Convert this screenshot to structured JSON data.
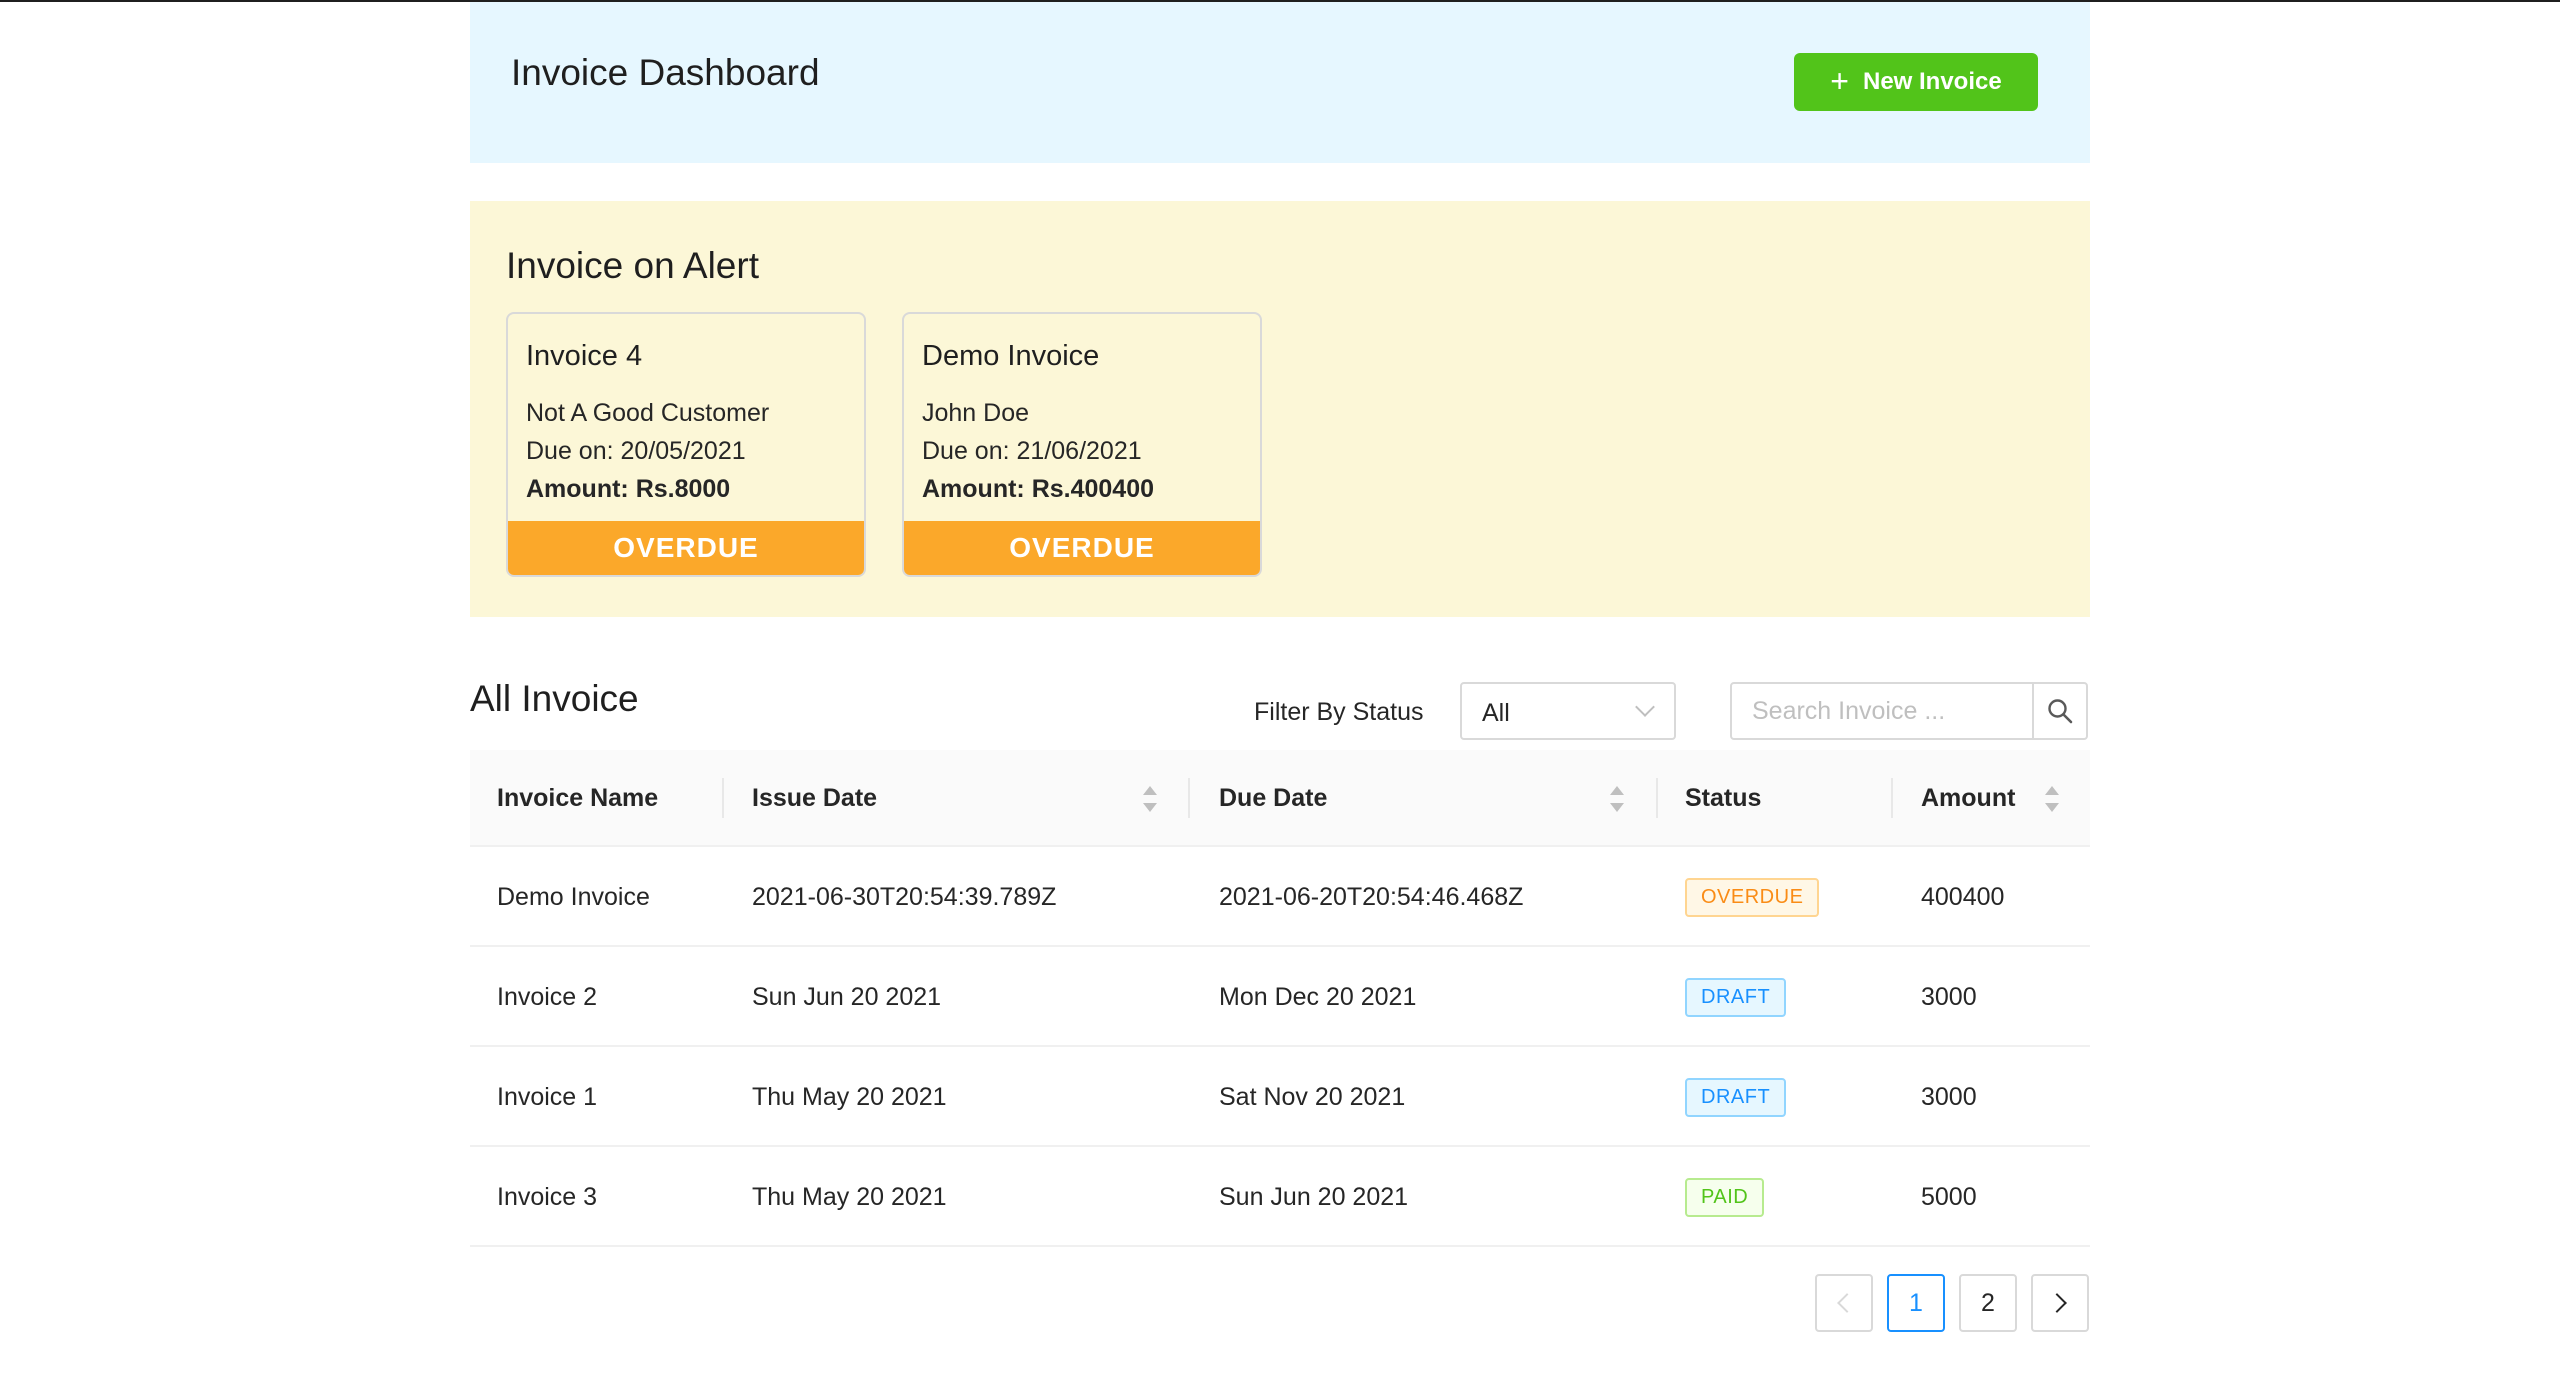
{
  "header": {
    "title": "Invoice Dashboard",
    "new_invoice_label": "New Invoice"
  },
  "alerts": {
    "title": "Invoice on Alert",
    "cards": [
      {
        "title": "Invoice 4",
        "customer": "Not A Good Customer",
        "due": "Due on: 20/05/2021",
        "amount": "Amount: Rs.8000",
        "status": "OVERDUE"
      },
      {
        "title": "Demo Invoice",
        "customer": "John Doe",
        "due": "Due on: 21/06/2021",
        "amount": "Amount: Rs.400400",
        "status": "OVERDUE"
      }
    ]
  },
  "all_invoice": {
    "title": "All Invoice",
    "filter_label": "Filter By Status",
    "filter_value": "All",
    "search_placeholder": "Search Invoice ..."
  },
  "table": {
    "columns": [
      "Invoice Name",
      "Issue Date",
      "Due Date",
      "Status",
      "Amount"
    ],
    "rows": [
      {
        "name": "Demo Invoice",
        "issue": "2021-06-30T20:54:39.789Z",
        "due": "2021-06-20T20:54:46.468Z",
        "status": "OVERDUE",
        "amount": "400400"
      },
      {
        "name": "Invoice 2",
        "issue": "Sun Jun 20 2021",
        "due": "Mon Dec 20 2021",
        "status": "DRAFT",
        "amount": "3000"
      },
      {
        "name": "Invoice 1",
        "issue": "Thu May 20 2021",
        "due": "Sat Nov 20 2021",
        "status": "DRAFT",
        "amount": "3000"
      },
      {
        "name": "Invoice 3",
        "issue": "Thu May 20 2021",
        "due": "Sun Jun 20 2021",
        "status": "PAID",
        "amount": "5000"
      }
    ]
  },
  "pagination": {
    "pages": [
      "1",
      "2"
    ],
    "current": "1"
  },
  "colors": {
    "header_bg": "#e6f7ff",
    "alert_bg": "#fcf7d7",
    "primary_button": "#52c41a",
    "overdue_banner": "#fba82a",
    "active_page": "#1890ff"
  }
}
